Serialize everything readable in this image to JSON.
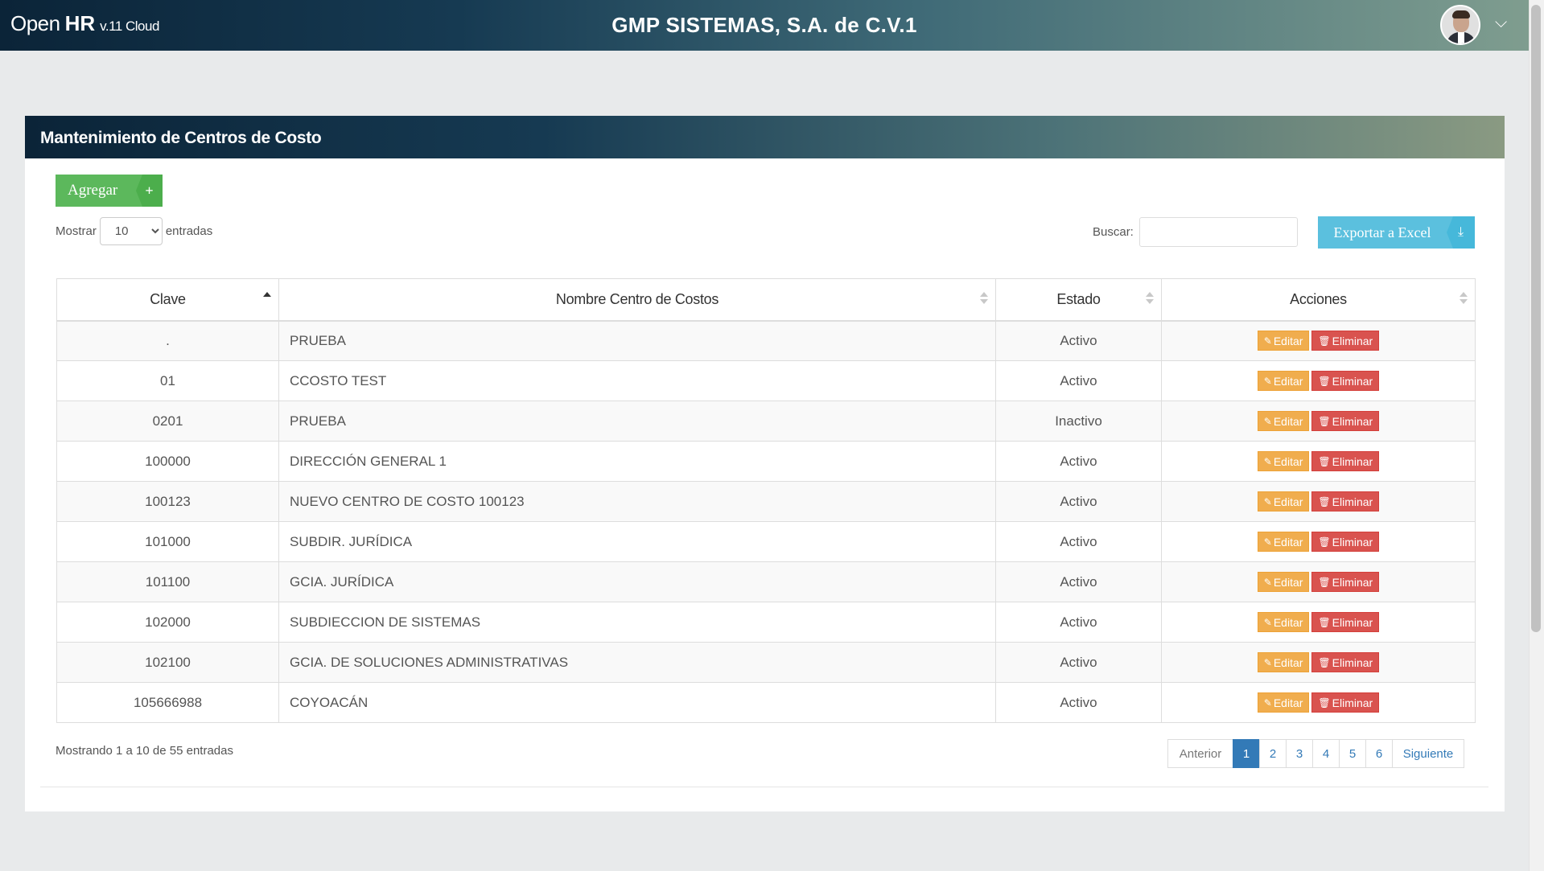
{
  "header": {
    "brand_open": "Open",
    "brand_hr": "HR",
    "brand_version": "v.11 Cloud",
    "company": "GMP SISTEMAS, S.A. de C.V.1",
    "user_menu_caret": "⌵"
  },
  "panel": {
    "title": "Mantenimiento de Centros de Costo",
    "add_label": "Agregar",
    "add_icon": "+",
    "length_before": "Mostrar",
    "length_value": "10",
    "length_after": "entradas",
    "search_label": "Buscar:",
    "search_value": "",
    "export_label": "Exportar a Excel",
    "export_icon": "⤓"
  },
  "table": {
    "columns": [
      "Clave",
      "Nombre Centro de Costos",
      "Estado",
      "Acciones"
    ],
    "edit_label": "Editar",
    "delete_label": "Eliminar",
    "rows": [
      {
        "clave": ".",
        "nombre": "PRUEBA",
        "estado": "Activo"
      },
      {
        "clave": "01",
        "nombre": "CCOSTO TEST",
        "estado": "Activo"
      },
      {
        "clave": "0201",
        "nombre": "PRUEBA",
        "estado": "Inactivo"
      },
      {
        "clave": "100000",
        "nombre": "DIRECCIÓN GENERAL 1",
        "estado": "Activo"
      },
      {
        "clave": "100123",
        "nombre": "NUEVO CENTRO DE COSTO 100123",
        "estado": "Activo"
      },
      {
        "clave": "101000",
        "nombre": "SUBDIR. JURÍDICA",
        "estado": "Activo"
      },
      {
        "clave": "101100",
        "nombre": "GCIA. JURÍDICA",
        "estado": "Activo"
      },
      {
        "clave": "102000",
        "nombre": "SUBDIECCION DE SISTEMAS",
        "estado": "Activo"
      },
      {
        "clave": "102100",
        "nombre": "GCIA. DE SOLUCIONES ADMINISTRATIVAS",
        "estado": "Activo"
      },
      {
        "clave": "105666988",
        "nombre": "COYOACÁN",
        "estado": "Activo"
      }
    ]
  },
  "footer": {
    "info": "Mostrando 1 a 10 de 55 entradas",
    "prev": "Anterior",
    "pages": [
      "1",
      "2",
      "3",
      "4",
      "5",
      "6"
    ],
    "active_page": "1",
    "next": "Siguiente"
  }
}
